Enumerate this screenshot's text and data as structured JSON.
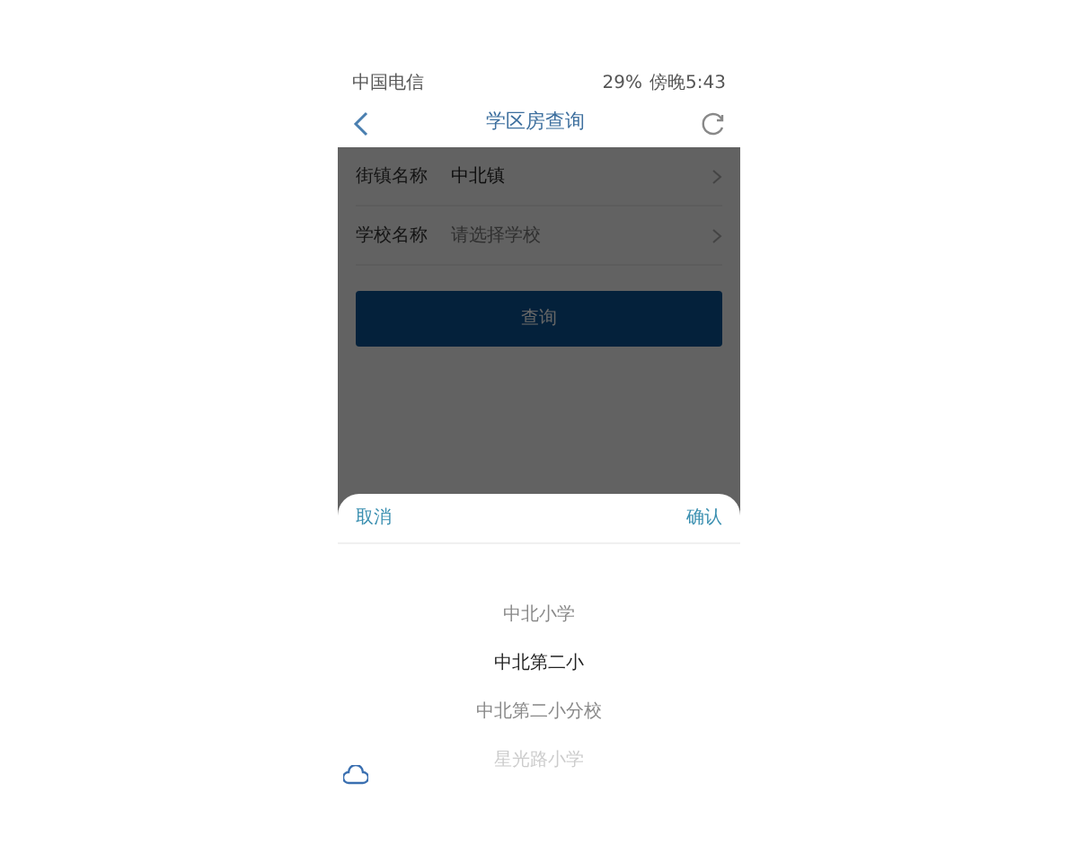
{
  "status_bar": {
    "carrier": "中国电信",
    "battery": "29%",
    "time": "傍晚5:43"
  },
  "nav": {
    "title": "学区房查询"
  },
  "form": {
    "rows": [
      {
        "label": "街镇名称",
        "value": "中北镇"
      },
      {
        "label": "学校名称",
        "placeholder": "请选择学校"
      }
    ],
    "submit": "查询"
  },
  "picker": {
    "cancel": "取消",
    "confirm": "确认",
    "options": [
      {
        "label": "中北小学",
        "selected": false
      },
      {
        "label": "中北第二小",
        "selected": true
      },
      {
        "label": "中北第二小分校",
        "selected": false
      },
      {
        "label": "星光路小学",
        "selected": false
      }
    ]
  }
}
